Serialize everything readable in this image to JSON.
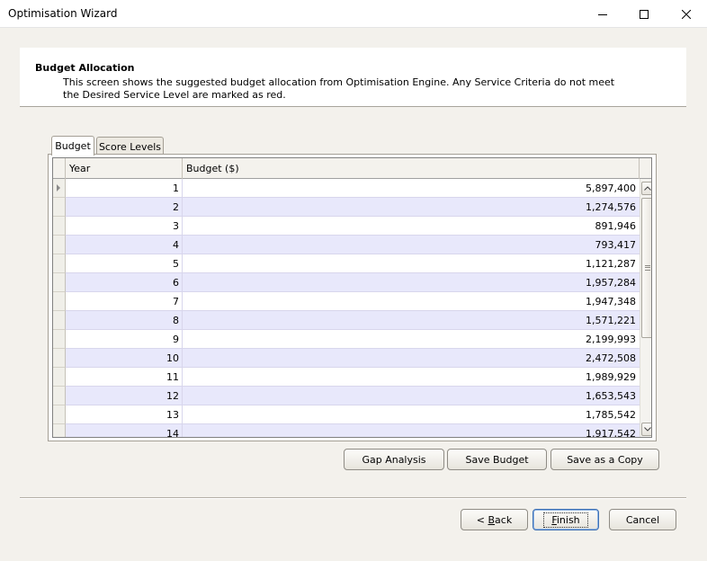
{
  "window": {
    "title": "Optimisation Wizard"
  },
  "header": {
    "title": "Budget Allocation",
    "description": "This screen shows the suggested budget allocation from Optimisation Engine. Any Service Criteria do not meet the Desired Service Level are marked as red."
  },
  "tabs": [
    {
      "label": "Budget",
      "selected": true
    },
    {
      "label": "Score Levels",
      "selected": false
    }
  ],
  "grid": {
    "columns": [
      "Year",
      "Budget ($)"
    ],
    "rows": [
      {
        "year": "1",
        "budget": "5,897,400"
      },
      {
        "year": "2",
        "budget": "1,274,576"
      },
      {
        "year": "3",
        "budget": "891,946"
      },
      {
        "year": "4",
        "budget": "793,417"
      },
      {
        "year": "5",
        "budget": "1,121,287"
      },
      {
        "year": "6",
        "budget": "1,957,284"
      },
      {
        "year": "7",
        "budget": "1,947,348"
      },
      {
        "year": "8",
        "budget": "1,571,221"
      },
      {
        "year": "9",
        "budget": "2,199,993"
      },
      {
        "year": "10",
        "budget": "2,472,508"
      },
      {
        "year": "11",
        "budget": "1,989,929"
      },
      {
        "year": "12",
        "budget": "1,653,543"
      },
      {
        "year": "13",
        "budget": "1,785,542"
      },
      {
        "year": "14",
        "budget": "1,917,542"
      }
    ],
    "row_colors": {
      "odd": "#ffffff",
      "even": "#e8e8fb"
    }
  },
  "actions": {
    "gap_analysis": "Gap Analysis",
    "save_budget": "Save Budget",
    "save_as_copy": "Save as a Copy"
  },
  "footer": {
    "back_prefix": "< ",
    "back_mnemonic": "B",
    "back_rest": "ack",
    "finish_mnemonic": "F",
    "finish_rest": "inish",
    "cancel": "Cancel"
  }
}
